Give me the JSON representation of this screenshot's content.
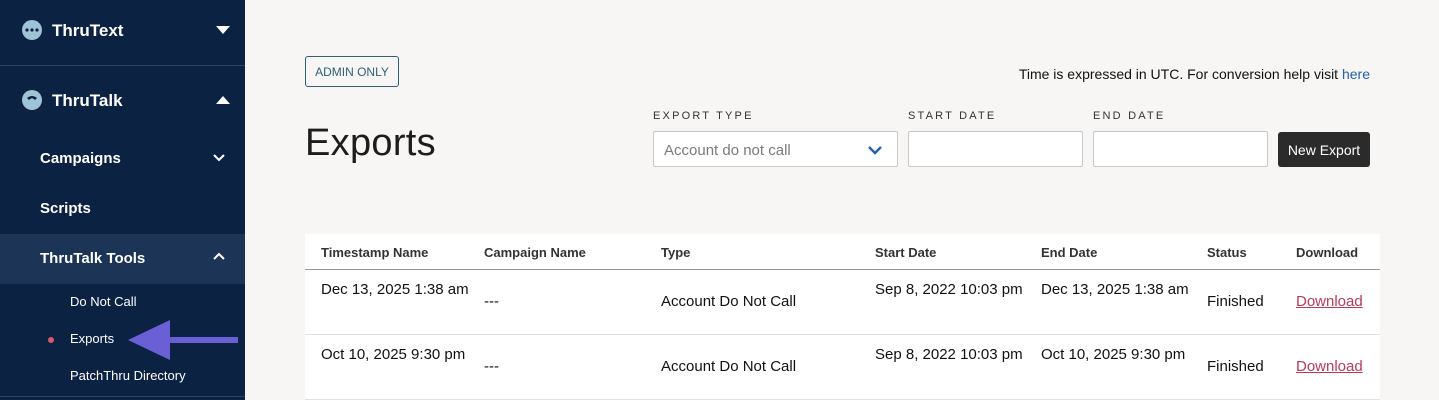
{
  "sidebar": {
    "brands": [
      {
        "label": "ThruText",
        "expanded": false
      },
      {
        "label": "ThruTalk",
        "expanded": true
      }
    ],
    "items": [
      {
        "label": "Campaigns"
      },
      {
        "label": "Scripts"
      },
      {
        "label": "ThruTalk Tools"
      }
    ],
    "sub_items": [
      {
        "label": "Do Not Call"
      },
      {
        "label": "Exports",
        "active": true
      },
      {
        "label": "PatchThru Directory"
      }
    ]
  },
  "main": {
    "admin_badge": "ADMIN ONLY",
    "tz_note": "Time is expressed in UTC. For conversion help visit ",
    "tz_link": "here",
    "title": "Exports",
    "filters": {
      "export_type_label": "EXPORT TYPE",
      "export_type_value": "Account do not call",
      "start_date_label": "START DATE",
      "start_date_value": "",
      "end_date_label": "END DATE",
      "end_date_value": ""
    },
    "new_export_button": "New Export",
    "table": {
      "headers": [
        "Timestamp Name",
        "Campaign Name",
        "Type",
        "Start Date",
        "End Date",
        "Status",
        "Download"
      ],
      "rows": [
        [
          "Dec 13, 2025 1:38 am",
          "---",
          "Account Do Not Call",
          "Sep 8, 2022 10:03 pm",
          "Dec 13, 2025 1:38 am",
          "Finished",
          "Download"
        ],
        [
          "Oct 10, 2025 9:30 pm",
          "---",
          "Account Do Not Call",
          "Sep 8, 2022 10:03 pm",
          "Oct 10, 2025 9:30 pm",
          "Finished",
          "Download"
        ]
      ]
    }
  },
  "colors": {
    "sidebar_bg": "#0c2243",
    "accent_link": "#2160b0",
    "download_link": "#b83a56",
    "arrow": "#6b5fd6"
  }
}
